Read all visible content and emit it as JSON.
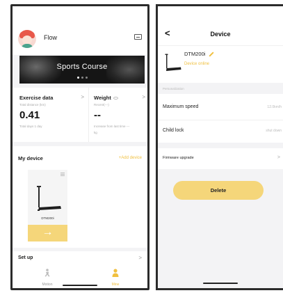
{
  "colors": {
    "accent": "#f5d67a",
    "accent_text": "#f0c040",
    "background": "#f3f3f5"
  },
  "left": {
    "user": {
      "name": "Flow"
    },
    "banner": {
      "title": "Sports Course",
      "slide_count": 3,
      "active_slide": 1
    },
    "exercise": {
      "title": "Exercise data",
      "subtitle": "Total distance (km)",
      "value": "0.41",
      "footer": "Total days 1 day"
    },
    "weight": {
      "title": "Weight",
      "subtitle": "Recent(---)",
      "value": "--",
      "footer_line1": "Increase from last time ---",
      "footer_line2": "kg"
    },
    "my_device": {
      "title": "My device",
      "add_label": "+Add device",
      "devices": [
        {
          "name": "DTM200i",
          "action_icon": "arrow-right-icon"
        }
      ]
    },
    "setup": {
      "label": "Set up"
    },
    "tabs": [
      {
        "label": "Motion",
        "icon": "runner-icon",
        "active": false
      },
      {
        "label": "Mine",
        "icon": "person-icon",
        "active": true
      }
    ]
  },
  "right": {
    "title": "Device",
    "device": {
      "name": "DTM200i",
      "status": "Device online"
    },
    "section_label": "Personalization",
    "rows": [
      {
        "label": "Maximum speed",
        "value": "12.0km/h"
      },
      {
        "label": "Child lock",
        "value": "shut down"
      },
      {
        "label": "Firmware upgrade",
        "value": ">"
      }
    ],
    "delete_label": "Delete"
  }
}
